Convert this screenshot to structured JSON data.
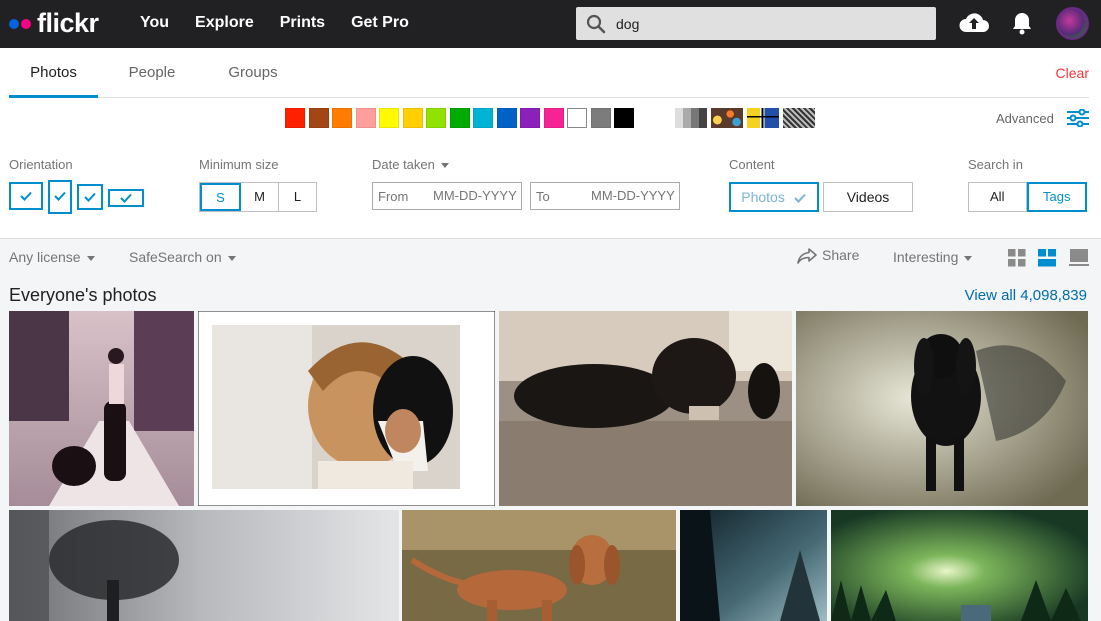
{
  "nav": {
    "logo": "flickr",
    "links": [
      "You",
      "Explore",
      "Prints",
      "Get Pro"
    ],
    "search_value": "dog"
  },
  "tabs": {
    "items": [
      "Photos",
      "People",
      "Groups"
    ],
    "active": "Photos",
    "clear": "Clear"
  },
  "colors": {
    "swatches": [
      "#ff2000",
      "#a24615",
      "#ff7c00",
      "#ff9f9c",
      "#fffa00",
      "#ffcf00",
      "#90e200",
      "#00ab00",
      "#00b2d4",
      "#0062c6",
      "#8c20ba",
      "#f52394",
      "#ffffff",
      "#7c7c7c",
      "#000000"
    ],
    "advanced": "Advanced"
  },
  "filters": {
    "orientation_label": "Orientation",
    "min_size_label": "Minimum size",
    "sizes": [
      "S",
      "M",
      "L"
    ],
    "size_selected": "S",
    "date_label": "Date taken",
    "from_label": "From",
    "to_label": "To",
    "date_placeholder": "MM-DD-YYYY",
    "content_label": "Content",
    "content_photos": "Photos",
    "content_videos": "Videos",
    "search_in_label": "Search in",
    "search_in_all": "All",
    "search_in_tags": "Tags",
    "search_in_selected": "Tags"
  },
  "toolbar": {
    "license": "Any license",
    "safesearch": "SafeSearch on",
    "share": "Share",
    "sort": "Interesting"
  },
  "results": {
    "title": "Everyone's photos",
    "view_all": "View all 4,098,839"
  },
  "accent": "#008ecf"
}
